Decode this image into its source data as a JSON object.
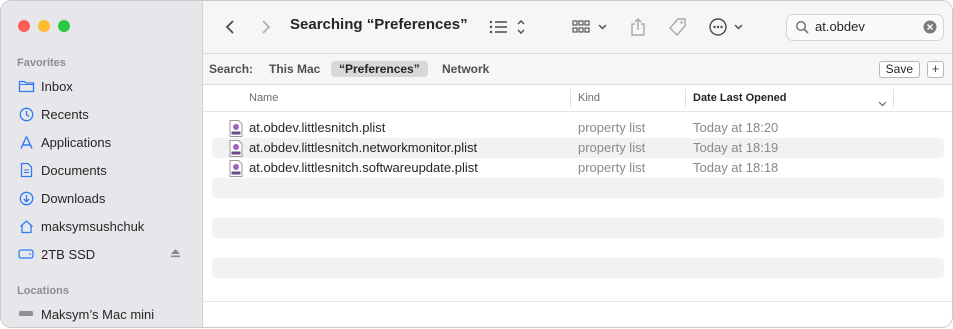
{
  "window": {
    "title": "Searching “Preferences”",
    "search_value": "at.obdev"
  },
  "sidebar": {
    "favorites_header": "Favorites",
    "favorites": [
      {
        "label": "Inbox",
        "icon": "folder-icon"
      },
      {
        "label": "Recents",
        "icon": "clock-icon"
      },
      {
        "label": "Applications",
        "icon": "applications-icon"
      },
      {
        "label": "Documents",
        "icon": "document-icon"
      },
      {
        "label": "Downloads",
        "icon": "download-icon"
      },
      {
        "label": "maksymsushchuk",
        "icon": "home-icon"
      },
      {
        "label": "2TB SSD",
        "icon": "drive-icon"
      }
    ],
    "locations_header": "Locations",
    "locations": [
      {
        "label": "Maksym’s Mac mini",
        "icon": "computer-icon"
      }
    ]
  },
  "scope": {
    "label": "Search:",
    "options": [
      "This Mac",
      "“Preferences”",
      "Network"
    ],
    "selected": "“Preferences”",
    "save_label": "Save",
    "add_label": "+"
  },
  "table": {
    "columns": [
      "Name",
      "Kind",
      "Date Last Opened"
    ],
    "rows": [
      {
        "name": "at.obdev.littlesnitch.plist",
        "kind": "property list",
        "date": "Today at 18:20"
      },
      {
        "name": "at.obdev.littlesnitch.networkmonitor.plist",
        "kind": "property list",
        "date": "Today at 18:19"
      },
      {
        "name": "at.obdev.littlesnitch.softwareupdate.plist",
        "kind": "property list",
        "date": "Today at 18:18"
      }
    ]
  },
  "colors": {
    "close": "#ff5f57",
    "minimize": "#febc2e",
    "zoom": "#28c840",
    "accent": "#2d7cf6"
  }
}
